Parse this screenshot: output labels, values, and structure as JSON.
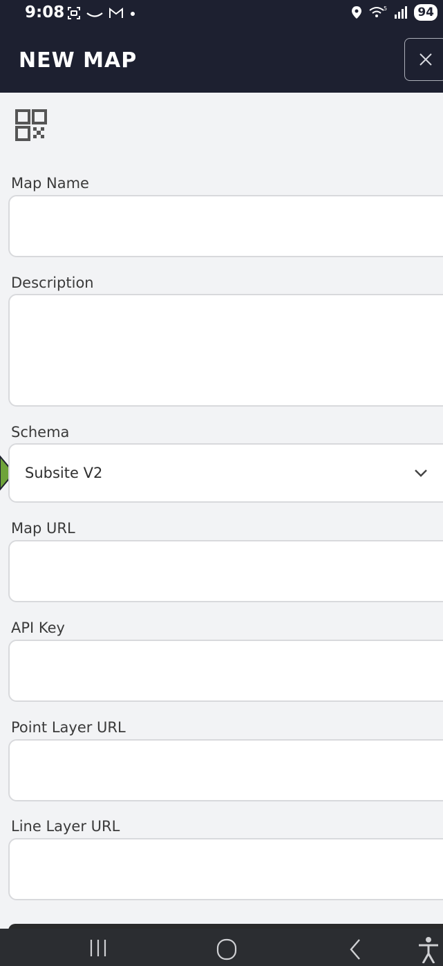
{
  "status_bar": {
    "time": "9:08",
    "battery": "94",
    "icons": [
      "screenshot-icon",
      "voicemail-icon",
      "gmail-icon",
      "dot-icon",
      "location-icon",
      "wifi-icon",
      "signal-icon"
    ]
  },
  "header": {
    "title": "NEW MAP",
    "close_icon": "close-icon"
  },
  "form": {
    "qr_icon": "qr-code-icon",
    "fields": [
      {
        "label": "Map Name",
        "value": ""
      },
      {
        "label": "Description",
        "value": ""
      },
      {
        "label": "Schema",
        "value": "Subsite V2"
      },
      {
        "label": "Map URL",
        "value": ""
      },
      {
        "label": "API Key",
        "value": ""
      },
      {
        "label": "Point Layer URL",
        "value": ""
      },
      {
        "label": "Line Layer URL",
        "value": ""
      }
    ]
  },
  "nav_bar": {
    "items": [
      "recent-apps-icon",
      "home-icon",
      "back-icon",
      "accessibility-icon"
    ]
  },
  "colors": {
    "header_bg": "#1d2030",
    "page_bg": "#f2f3f5",
    "marker": "#6ea33a"
  }
}
